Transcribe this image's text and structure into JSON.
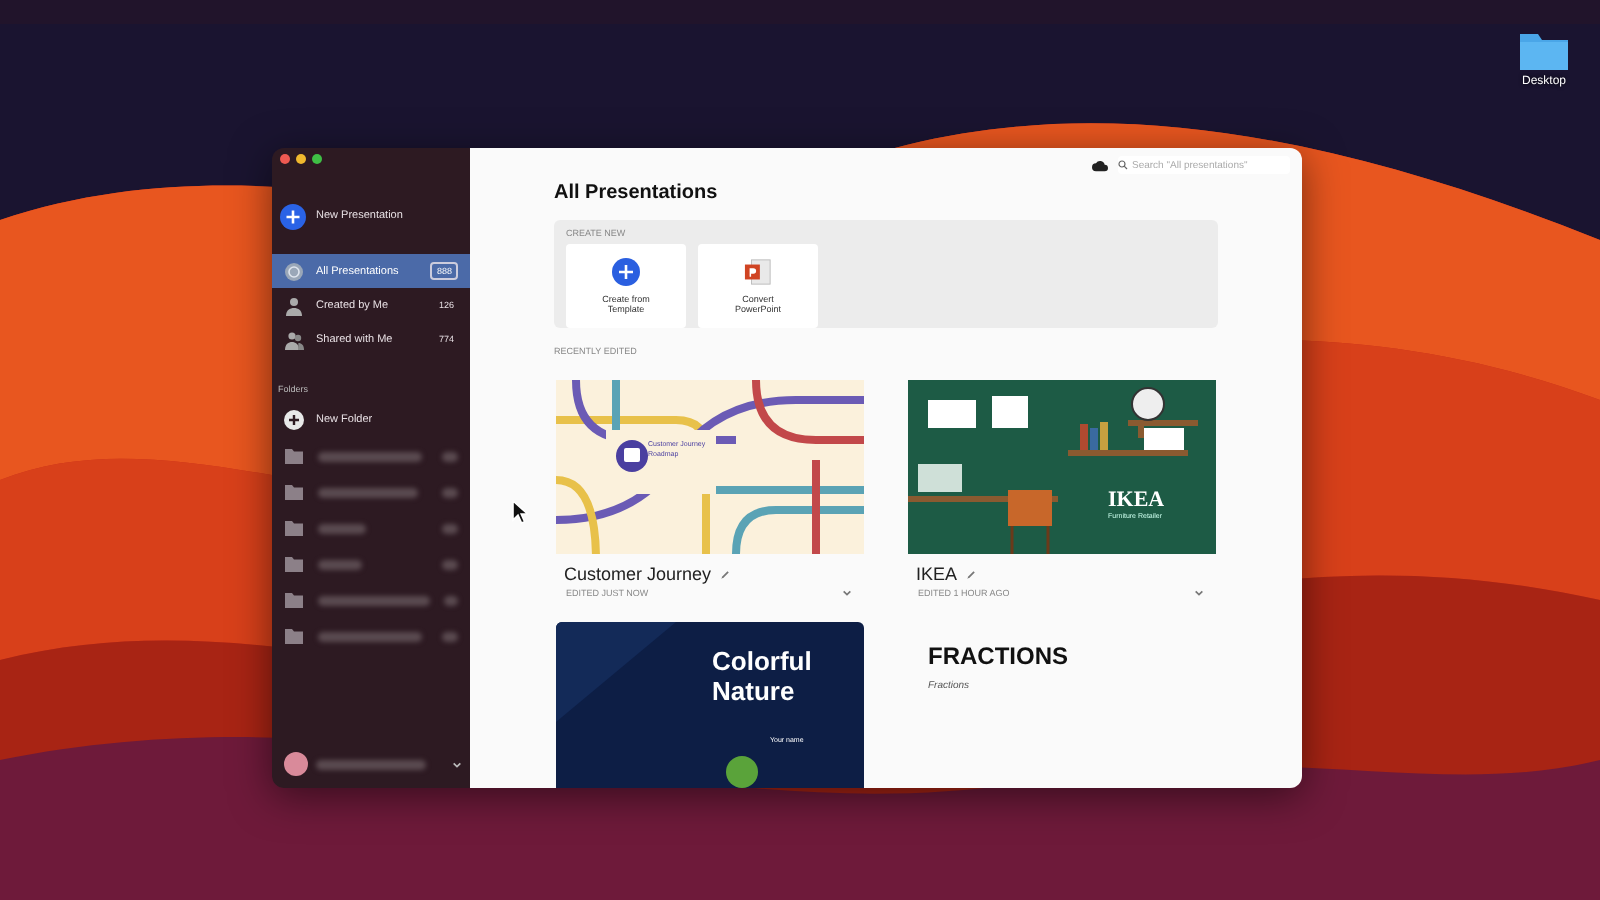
{
  "desktop": {
    "icon_label": "Desktop"
  },
  "sidebar": {
    "new_button": "New Presentation",
    "nav": [
      {
        "kind": "all",
        "label": "All Presentations",
        "count": "888",
        "selected": true
      },
      {
        "kind": "mine",
        "label": "Created by Me",
        "count": "126",
        "selected": false
      },
      {
        "kind": "shared",
        "label": "Shared with Me",
        "count": "774",
        "selected": false
      }
    ],
    "folders_heading": "Folders",
    "new_folder": "New Folder",
    "folders": [
      {
        "redacted": true
      },
      {
        "redacted": true
      },
      {
        "redacted": true
      },
      {
        "redacted": true
      },
      {
        "redacted": true
      },
      {
        "redacted": true
      }
    ],
    "account": {
      "redacted": true
    }
  },
  "toolbar": {
    "search": {
      "placeholder": "Search \"All presentations\""
    }
  },
  "main": {
    "title": "All Presentations",
    "create_new": {
      "heading": "CREATE NEW",
      "options": [
        {
          "kind": "template",
          "label": "Create from Template"
        },
        {
          "kind": "powerpoint",
          "label": "Convert PowerPoint"
        }
      ]
    },
    "recent_heading": "RECENTLY EDITED",
    "presentations": [
      {
        "kind": "roadmap",
        "title": "Customer Journey",
        "edited": "EDITED JUST NOW",
        "slide_text": [
          "Customer Journey Roadmap"
        ]
      },
      {
        "kind": "office",
        "title": "IKEA",
        "edited": "EDITED 1 HOUR AGO",
        "slide_text": [
          "IKEA",
          "Furniture Retailer"
        ]
      },
      {
        "kind": "nature",
        "slide_text": [
          "Colorful Nature",
          "Your name"
        ]
      },
      {
        "kind": "text",
        "slide_text": [
          "FRACTIONS",
          "Fractions"
        ]
      }
    ]
  }
}
